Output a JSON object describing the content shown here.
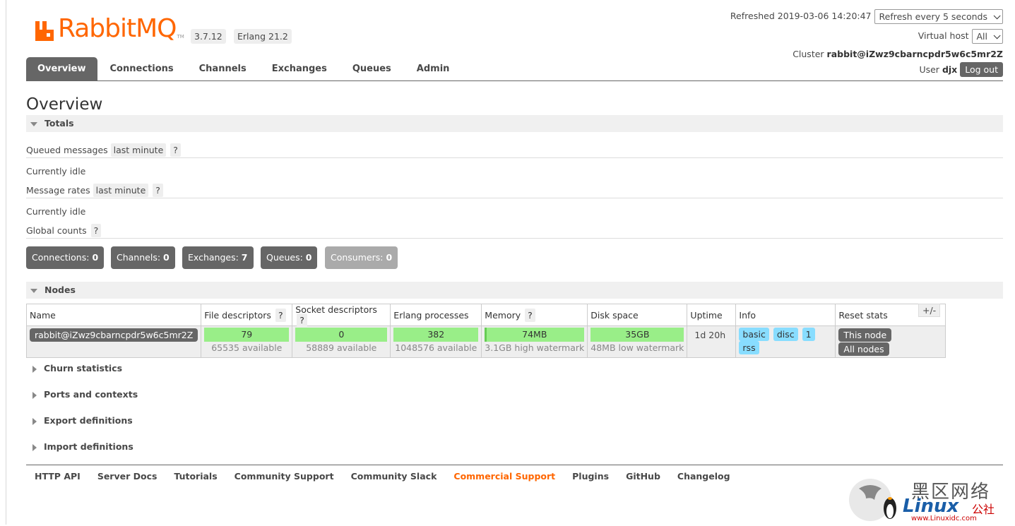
{
  "app": {
    "logo_text": "RabbitMQ",
    "logo_tm": "TM",
    "version": "3.7.12",
    "erlang": "Erlang 21.2",
    "brand_color": "#ff6600"
  },
  "header": {
    "refreshed_label": "Refreshed",
    "refreshed_time": "2019-03-06 14:20:47",
    "refresh_select": "Refresh every 5 seconds",
    "vhost_label": "Virtual host",
    "vhost_select": "All",
    "cluster_label": "Cluster",
    "cluster_name": "rabbit@iZwz9cbarncpdr5w6c5mr2Z",
    "user_label": "User",
    "user_name": "djx",
    "logout": "Log out"
  },
  "tabs": [
    {
      "label": "Overview",
      "active": true
    },
    {
      "label": "Connections"
    },
    {
      "label": "Channels"
    },
    {
      "label": "Exchanges"
    },
    {
      "label": "Queues"
    },
    {
      "label": "Admin"
    }
  ],
  "page_title": "Overview",
  "totals": {
    "title": "Totals",
    "queued_label": "Queued messages",
    "queued_range": "last minute",
    "help": "?",
    "idle1": "Currently idle",
    "rates_label": "Message rates",
    "rates_range": "last minute",
    "idle2": "Currently idle",
    "global_label": "Global counts",
    "counts": [
      {
        "label": "Connections:",
        "value": "0"
      },
      {
        "label": "Channels:",
        "value": "0"
      },
      {
        "label": "Exchanges:",
        "value": "7"
      },
      {
        "label": "Queues:",
        "value": "0"
      },
      {
        "label": "Consumers:",
        "value": "0"
      }
    ]
  },
  "nodes": {
    "title": "Nodes",
    "columns": [
      "Name",
      "File descriptors",
      "Socket descriptors",
      "Erlang processes",
      "Memory",
      "Disk space",
      "Uptime",
      "Info",
      "Reset stats"
    ],
    "row": {
      "name": "rabbit@iZwz9cbarncpdr5w6c5mr2Z",
      "fd": "79",
      "fd_avail": "65535 available",
      "sd": "0",
      "sd_avail": "58889 available",
      "ep": "382",
      "ep_avail": "1048576 available",
      "mem": "74MB",
      "mem_sub": "3.1GB high watermark",
      "disk": "35GB",
      "disk_sub": "48MB low watermark",
      "uptime": "1d 20h",
      "info": [
        "basic",
        "disc",
        "1",
        "rss"
      ],
      "reset_this": "This node",
      "reset_all": "All nodes"
    },
    "plus_minus": "+/-"
  },
  "collapsed_sections": [
    "Churn statistics",
    "Ports and contexts",
    "Export definitions",
    "Import definitions"
  ],
  "footer": [
    "HTTP API",
    "Server Docs",
    "Tutorials",
    "Community Support",
    "Community Slack",
    "Commercial Support",
    "Plugins",
    "GitHub",
    "Changelog"
  ],
  "watermark": {
    "cn": "黑区网络",
    "brand": "Linux",
    "suffix": "公社",
    "url": "www.Linuxidc.com"
  }
}
